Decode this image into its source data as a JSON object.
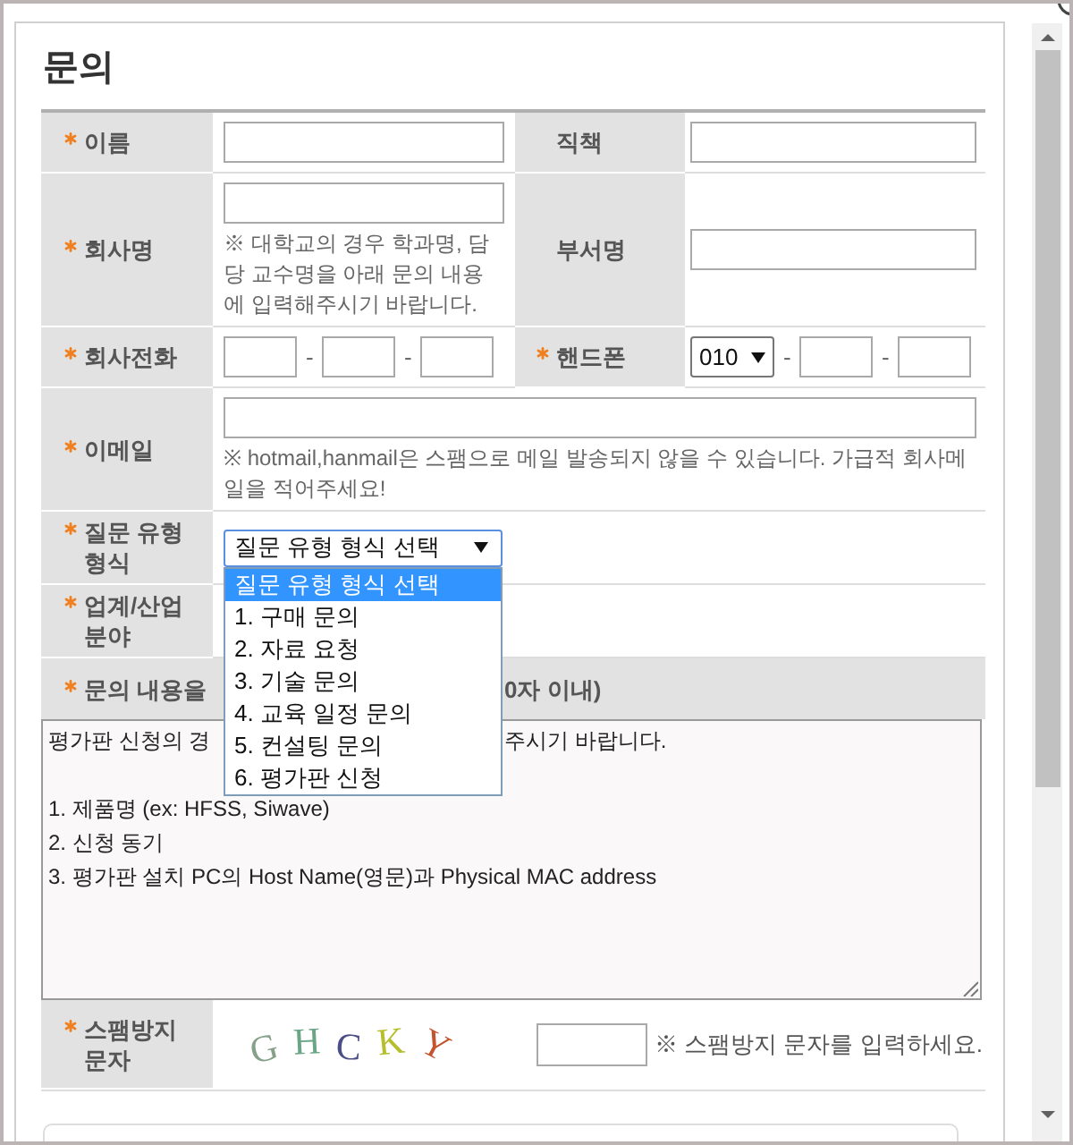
{
  "dialog": {
    "title": "문의"
  },
  "form": {
    "rows": [
      {
        "cells": [
          {
            "label": "이름",
            "required": true,
            "input": {
              "kind": "text"
            }
          },
          {
            "label": "직책",
            "required": false,
            "input": {
              "kind": "text"
            }
          }
        ]
      },
      {
        "cells": [
          {
            "label": "회사명",
            "required": true,
            "input": {
              "kind": "text",
              "note": "※ 대학교의 경우 학과명, 담당 교수명을 아래 문의 내용에 입력해주시기 바랍니다."
            }
          },
          {
            "label": "부서명",
            "required": false,
            "input": {
              "kind": "text"
            }
          }
        ]
      },
      {
        "cells": [
          {
            "label": "회사전화",
            "required": true,
            "input": {
              "kind": "phone",
              "separators": [
                "-",
                "-"
              ]
            }
          },
          {
            "label": "핸드폰",
            "required": true,
            "input": {
              "kind": "phone",
              "prefix": "010",
              "separators": [
                "-",
                "-"
              ]
            }
          }
        ]
      },
      {
        "cells": [
          {
            "label": "이메일",
            "required": true,
            "input": {
              "kind": "text",
              "note": "※ hotmail,hanmail은 스팸으로 메일 발송되지 않을 수 있습니다. 가급적 회사메일을 적어주세요!"
            }
          }
        ]
      },
      {
        "cells": [
          {
            "label": "질문 유형 형식",
            "required": true,
            "input": {
              "kind": "dropdown",
              "value": "질문 유형 형식 선택",
              "expanded": true
            }
          }
        ]
      },
      {
        "cells": [
          {
            "label": "업계/산업 분야",
            "required": true
          }
        ]
      }
    ],
    "open_dropdown": {
      "options": [
        {
          "label": "질문 유형 형식 선택",
          "selected": true
        },
        {
          "label": "1. 구매 문의",
          "selected": false
        },
        {
          "label": "2. 자료 요청",
          "selected": false
        },
        {
          "label": "3. 기술 문의",
          "selected": false
        },
        {
          "label": "4. 교육 일정 문의",
          "selected": false
        },
        {
          "label": "5. 컨설팅 문의",
          "selected": false
        },
        {
          "label": "6. 평가판 신청",
          "selected": false
        }
      ]
    },
    "message": {
      "label_start": "문의 내용을",
      "label_end": "0자 이내)",
      "required": true,
      "first_line": {
        "start": "평가판 신청의 경",
        "end": "주시기 바랍니다."
      },
      "lines": [
        "1. 제품명 (ex: HFSS, Siwave)",
        "2. 신청 동기",
        "3. 평가판 설치 PC의 Host Name(영문)과 Physical MAC address"
      ]
    },
    "spam": {
      "label": "스팸방지 문자",
      "required": true,
      "captcha": [
        {
          "char": "G",
          "color": "#86a08a"
        },
        {
          "char": "H",
          "color": "#6aa585"
        },
        {
          "char": "C",
          "color": "#4b4f86"
        },
        {
          "char": "K",
          "color": "#b6be2e"
        },
        {
          "char": "Y",
          "color": "#c3542e"
        }
      ],
      "note": "※ 스팸방지 문자를 입력하세요."
    }
  }
}
